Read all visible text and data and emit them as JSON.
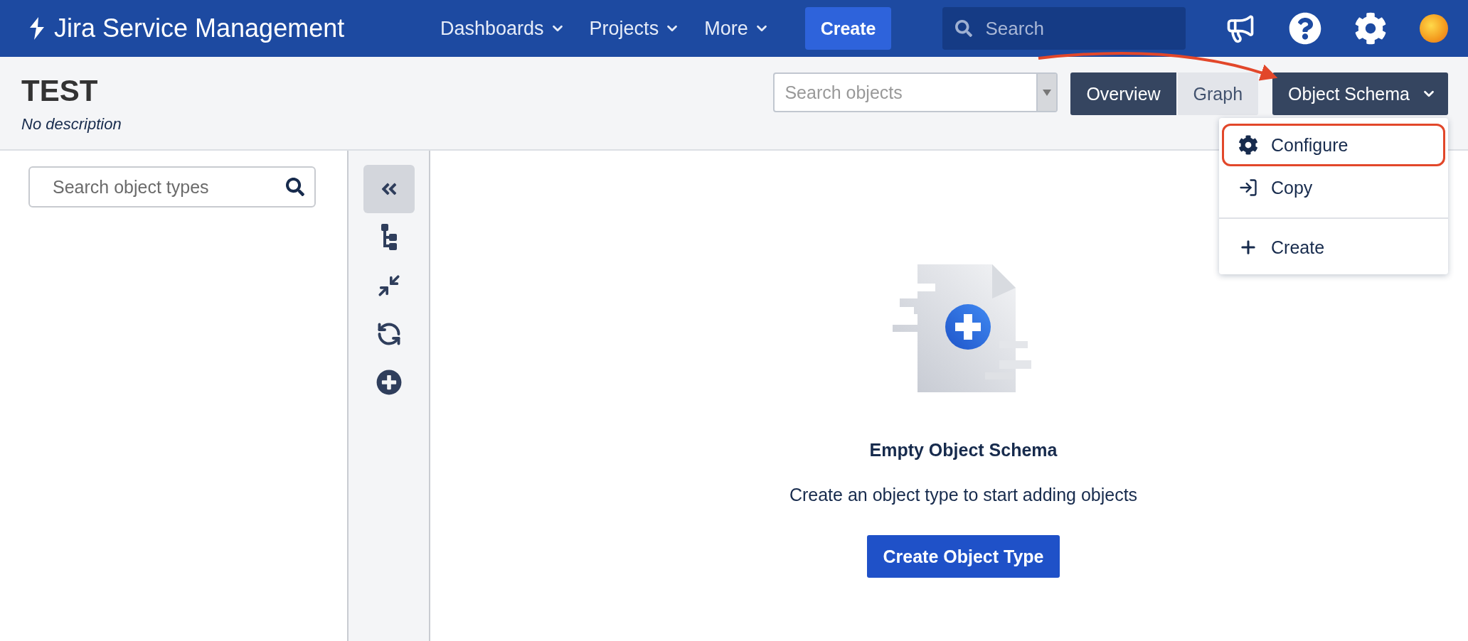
{
  "nav": {
    "product": "Jira Service Management",
    "items": [
      {
        "label": "Dashboards"
      },
      {
        "label": "Projects"
      },
      {
        "label": "More"
      }
    ],
    "create": "Create",
    "search": {
      "placeholder": "Search"
    }
  },
  "header": {
    "title": "TEST",
    "description": "No description",
    "search": {
      "placeholder": "Search objects"
    },
    "views": [
      {
        "label": "Overview",
        "selected": true
      },
      {
        "label": "Graph",
        "selected": false
      }
    ],
    "schema_menu": {
      "label": "Object Schema",
      "expanded": true,
      "groups": [
        [
          {
            "kind": "configure",
            "label": "Configure",
            "highlighted": true
          },
          {
            "kind": "copy",
            "label": "Copy",
            "highlighted": false
          }
        ],
        [
          {
            "kind": "create",
            "label": "Create",
            "highlighted": false
          }
        ]
      ]
    }
  },
  "sidebar": {
    "search": {
      "placeholder": "Search object types"
    }
  },
  "toolbar": [
    {
      "kind": "collapse",
      "selected": true
    },
    {
      "kind": "tree",
      "selected": false
    },
    {
      "kind": "compress",
      "selected": false
    },
    {
      "kind": "refresh",
      "selected": false
    },
    {
      "kind": "add",
      "selected": false
    }
  ],
  "empty_state": {
    "title": "Empty Object Schema",
    "text": "Create an object type to start adding objects",
    "button": "Create Object Type"
  }
}
